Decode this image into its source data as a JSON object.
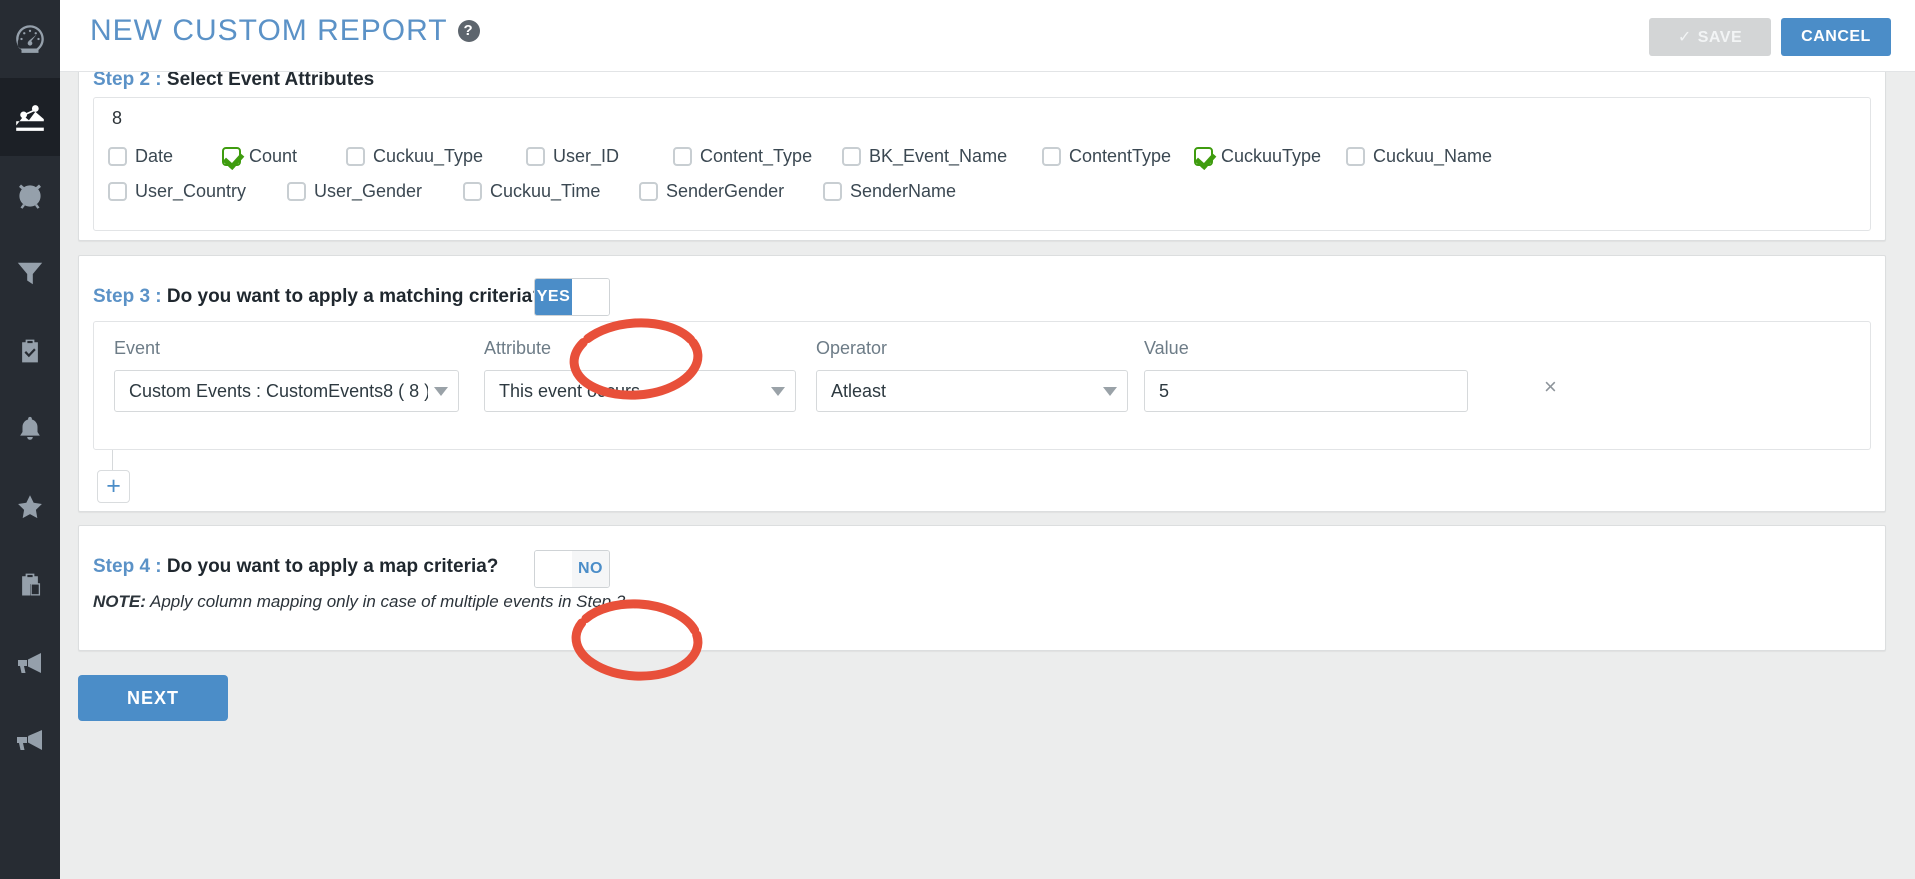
{
  "header": {
    "title": "NEW CUSTOM REPORT",
    "help_icon": "question-mark-icon",
    "save_label": "SAVE",
    "save_check": "✓",
    "cancel_label": "CANCEL"
  },
  "sidebar": {
    "items": [
      {
        "icon": "dashboard-gauge-icon",
        "active": false
      },
      {
        "icon": "analytics-chart-icon",
        "active": true
      },
      {
        "icon": "alarm-clock-icon",
        "active": false
      },
      {
        "icon": "funnel-filter-icon",
        "active": false
      },
      {
        "icon": "clipboard-check-icon",
        "active": false
      },
      {
        "icon": "bell-notification-icon",
        "active": false
      },
      {
        "icon": "star-favorite-icon",
        "active": false
      },
      {
        "icon": "clipboard-paste-icon",
        "active": false
      },
      {
        "icon": "megaphone-icon",
        "active": false
      },
      {
        "icon": "megaphone-alt-icon",
        "active": false
      }
    ]
  },
  "step2": {
    "step_prefix": "Step 2 : ",
    "heading": "Select Event Attributes",
    "count": "8",
    "attributes_row1": [
      {
        "label": "Date",
        "checked": false
      },
      {
        "label": "Count",
        "checked": true
      },
      {
        "label": "Cuckuu_Type",
        "checked": false
      },
      {
        "label": "User_ID",
        "checked": false
      },
      {
        "label": "Content_Type",
        "checked": false
      },
      {
        "label": "BK_Event_Name",
        "checked": false
      },
      {
        "label": "ContentType",
        "checked": false
      },
      {
        "label": "CuckuuType",
        "checked": true
      },
      {
        "label": "Cuckuu_Name",
        "checked": false
      }
    ],
    "attributes_row2": [
      {
        "label": "User_Country",
        "checked": false
      },
      {
        "label": "User_Gender",
        "checked": false
      },
      {
        "label": "Cuckuu_Time",
        "checked": false
      },
      {
        "label": "SenderGender",
        "checked": false
      },
      {
        "label": "SenderName",
        "checked": false
      }
    ]
  },
  "step3": {
    "step_prefix": "Step 3 : ",
    "heading": "Do you want to apply a matching criteria?",
    "toggle_value": "YES",
    "toggle_on_label": "YES",
    "fields": {
      "event_label": "Event",
      "event_value": "Custom Events : CustomEvents8 ( 8 )",
      "attribute_label": "Attribute",
      "attribute_value": "This event occurs",
      "operator_label": "Operator",
      "operator_value": "Atleast",
      "value_label": "Value",
      "value_value": "5"
    },
    "remove_icon": "×",
    "add_label": "+"
  },
  "step4": {
    "step_prefix": "Step 4 : ",
    "heading": "Do you want to apply a map criteria?",
    "toggle_value": "NO",
    "toggle_off_label": "NO",
    "note_prefix": "NOTE:",
    "note_text": " Apply column mapping only in case of multiple events in Step 3."
  },
  "footer": {
    "next_label": "NEXT"
  },
  "annotations": {
    "circle_yes": "red-ellipse-highlight-yes-toggle",
    "circle_no": "red-ellipse-highlight-no-toggle",
    "circle_color": "#e8503a"
  },
  "colors": {
    "accent_blue": "#4b8dc8",
    "title_blue": "#5b92c7",
    "checked_green": "#3f9c0f",
    "sidebar_bg": "#272c33",
    "page_bg": "#eceded",
    "annotation_red": "#e8503a"
  }
}
